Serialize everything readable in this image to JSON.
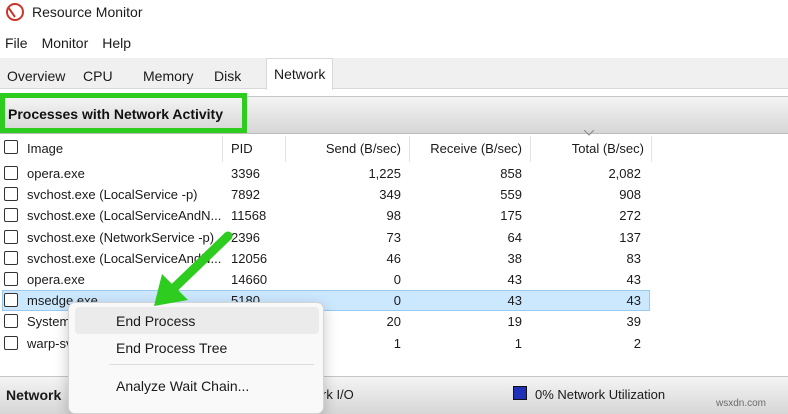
{
  "window": {
    "title": "Resource Monitor"
  },
  "menu": [
    "File",
    "Monitor",
    "Help"
  ],
  "tabs": [
    "Overview",
    "CPU",
    "Memory",
    "Disk",
    "Network"
  ],
  "active_tab": "Network",
  "section": {
    "title": "Processes with Network Activity"
  },
  "columns": [
    "Image",
    "PID",
    "Send (B/sec)",
    "Receive (B/sec)",
    "Total (B/sec)"
  ],
  "rows": [
    {
      "image": "opera.exe",
      "pid": "3396",
      "send": "1,225",
      "receive": "858",
      "total": "2,082"
    },
    {
      "image": "svchost.exe (LocalService -p)",
      "pid": "7892",
      "send": "349",
      "receive": "559",
      "total": "908"
    },
    {
      "image": "svchost.exe (LocalServiceAndN...",
      "pid": "11568",
      "send": "98",
      "receive": "175",
      "total": "272"
    },
    {
      "image": "svchost.exe (NetworkService -p)",
      "pid": "2396",
      "send": "73",
      "receive": "64",
      "total": "137"
    },
    {
      "image": "svchost.exe (LocalServiceAndN...",
      "pid": "12056",
      "send": "46",
      "receive": "38",
      "total": "83"
    },
    {
      "image": "opera.exe",
      "pid": "14660",
      "send": "0",
      "receive": "43",
      "total": "43"
    },
    {
      "image": "msedge.exe",
      "pid": "5180",
      "send": "0",
      "receive": "43",
      "total": "43"
    },
    {
      "image": "System",
      "pid": "",
      "send": "20",
      "receive": "19",
      "total": "39"
    },
    {
      "image": "warp-sv",
      "pid": "",
      "send": "1",
      "receive": "1",
      "total": "2"
    }
  ],
  "context_menu": [
    "End Process",
    "End Process Tree",
    "Analyze Wait Chain..."
  ],
  "lower_section": {
    "title": "Network",
    "io_label": "rk I/O",
    "utilization": "0% Network Utilization"
  },
  "watermark": "wsxdn.com",
  "colors": {
    "highlight_green": "#2ecc1f",
    "selection": "#cce8ff",
    "utilization_swatch": "#1f2fb8"
  }
}
